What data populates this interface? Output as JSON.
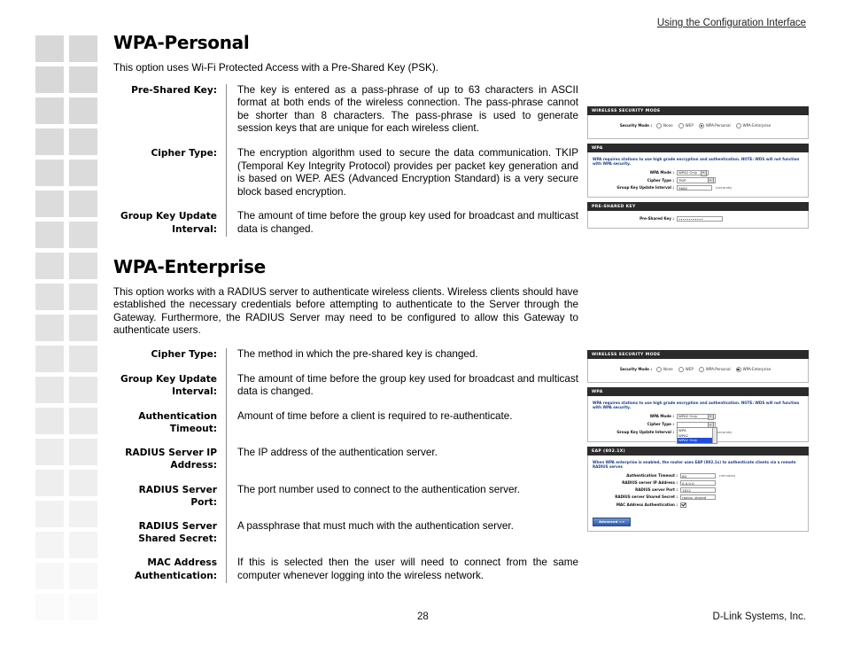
{
  "header": {
    "running_title": "Using the Configuration Interface"
  },
  "footer": {
    "page_number": "28",
    "company": "D-Link Systems, Inc."
  },
  "sections": [
    {
      "title": "WPA-Personal",
      "intro": "This option uses Wi-Fi Protected Access with a Pre-Shared Key (PSK).",
      "definitions": [
        {
          "label": "Pre-Shared Key:",
          "description": "The key is entered as a pass-phrase of up to 63 characters in ASCII format at both ends of the wireless connection. The pass-phrase cannot be shorter than 8 characters. The pass-phrase is used to generate session keys that are unique for each wireless client."
        },
        {
          "label": "Cipher Type:",
          "description": "The encryption algorithm used to secure the data communication. TKIP (Temporal Key Integrity Protocol) provides per packet key generation and is based on WEP. AES (Advanced Encryption Standard) is a very secure block based encryption."
        },
        {
          "label": "Group Key Update Interval:",
          "description": "The amount of time before the group key used for broadcast and multicast data is changed."
        }
      ]
    },
    {
      "title": "WPA-Enterprise",
      "intro": "This option works with a RADIUS server to authenticate wireless clients. Wireless clients should have established the necessary credentials before attempting to authenticate to the Server through the Gateway. Furthermore, the RADIUS Server may need to be configured to allow this Gateway to authenticate users.",
      "definitions": [
        {
          "label": "Cipher Type:",
          "description": "The method in which the pre-shared key is changed."
        },
        {
          "label": "Group Key Update Interval:",
          "description": "The amount of time before the group key used for broadcast and multicast data is changed."
        },
        {
          "label": "Authentication Timeout:",
          "description": "Amount of time before a client is required to re-authenticate."
        },
        {
          "label": "RADIUS Server IP Address:",
          "description": "The IP address of the authentication server."
        },
        {
          "label": "RADIUS Server Port:",
          "description": "The port number used to connect to the authentication server."
        },
        {
          "label": "RADIUS Server Shared Secret:",
          "description": "A passphrase that must much with the authentication server."
        },
        {
          "label": "MAC Address Authentication:",
          "description": "If this is selected then the user will need to connect from the same computer whenever logging into the wireless network."
        }
      ]
    }
  ],
  "screenshot_personal": {
    "security_panel": {
      "header": "WIRELESS SECURITY MODE",
      "mode_label": "Security Mode :",
      "options": [
        "None",
        "WEP",
        "WPA-Personal",
        "WPA-Enterprise"
      ],
      "selected": "WPA-Personal"
    },
    "wpa_panel": {
      "header": "WPA",
      "note": "WPA requires stations to use high grade encryption and authentication. NOTE: WDS will not function with WPA security.",
      "wpa_mode_label": "WPA Mode :",
      "wpa_mode_value": "WPA2 Only",
      "cipher_label": "Cipher Type :",
      "cipher_value": "TKIP",
      "group_key_label": "Group Key Update Interval :",
      "group_key_value": "3600",
      "group_key_unit": "(seconds)"
    },
    "psk_panel": {
      "header": "PRE-SHARED KEY",
      "psk_label": "Pre-Shared Key :",
      "psk_value": "••••••••••••"
    }
  },
  "screenshot_enterprise": {
    "security_panel": {
      "header": "WIRELESS SECURITY MODE",
      "mode_label": "Security Mode :",
      "options": [
        "None",
        "WEP",
        "WPA-Personal",
        "WPA-Enterprise"
      ],
      "selected": "WPA-Enterprise"
    },
    "wpa_panel": {
      "header": "WPA",
      "note": "WPA requires stations to use high grade encryption and authentication. NOTE: WDS will not function with WPA security.",
      "wpa_mode_label": "WPA Mode :",
      "wpa_mode_value": "WPA2 Only",
      "cipher_label": "Cipher Type :",
      "cipher_dropdown_options": [
        "WPA",
        "WPA2",
        "WPA2 Only"
      ],
      "cipher_dropdown_selected": "WPA2 Only",
      "group_key_label": "Group Key Update Interval :",
      "group_key_unit": "(seconds)"
    },
    "eap_panel": {
      "header": "EAP (802.1X)",
      "note": "When WPA enterprise is enabled, the router uses EAP (802.1x) to authenticate clients via a remote RADIUS server.",
      "fields": [
        {
          "label": "Authentication Timeout :",
          "value": "60",
          "unit": "(minutes)"
        },
        {
          "label": "RADIUS server IP Address :",
          "value": "0.0.0.0",
          "unit": ""
        },
        {
          "label": "RADIUS server Port :",
          "value": "1812",
          "unit": ""
        },
        {
          "label": "RADIUS server Shared Secret :",
          "value": "radius_shared",
          "unit": ""
        },
        {
          "label": "MAC Address Authentication :",
          "value": "",
          "unit": ""
        }
      ],
      "advanced_button": "Advanced >>"
    }
  }
}
